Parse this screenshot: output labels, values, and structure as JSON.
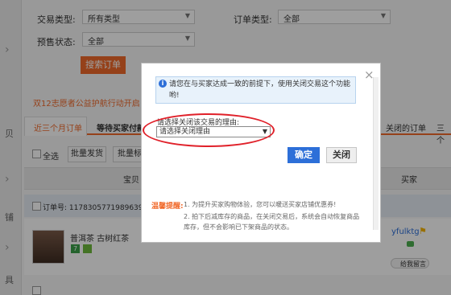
{
  "filters": {
    "trade_type_label": "交易类型:",
    "trade_type_value": "所有类型",
    "order_type_label": "订单类型:",
    "order_type_value": "全部",
    "presale_label": "预售状态:",
    "presale_value": "全部",
    "search_button": "搜索订单"
  },
  "notice_text": "双12志愿者公益护航行动开启!",
  "tabs": [
    "近三个月订单",
    "等待买家付款",
    "关闭的订单",
    "三个"
  ],
  "toolbar": {
    "select_all": "全选",
    "batch_ship": "批量发货",
    "batch_other": "批量标"
  },
  "table": {
    "col_item": "宝贝",
    "col_buyer": "买家",
    "order_no": "订单号: 11783057719896391",
    "item_title": "普洱茶 古树红茶",
    "buyer_name": "yfulktg",
    "leave_msg": "给我留言"
  },
  "gutter_texts": [
    "贝",
    "铺",
    "具"
  ],
  "dialog": {
    "info_text": "请您在与买家达成一致的前提下，使用关闭交易这个功能哟!",
    "reason_label": "请选择关闭该交易的理由:",
    "reason_value": "请选择关闭理由",
    "confirm": "确定",
    "close": "关闭",
    "tips_title": "温馨提醒:",
    "tip1": "1. 为提升买家购物体验，您可以暖送买家店铺优惠券!",
    "tip2": "2. 拍下后减库存的商品，在关闭交易后，系统会自动恢复商品库存，但不会影响已下架商品的状态。"
  },
  "colors": {
    "accent": "#f16a2b",
    "primary": "#2d6fd8",
    "annotation": "#e0212a"
  }
}
